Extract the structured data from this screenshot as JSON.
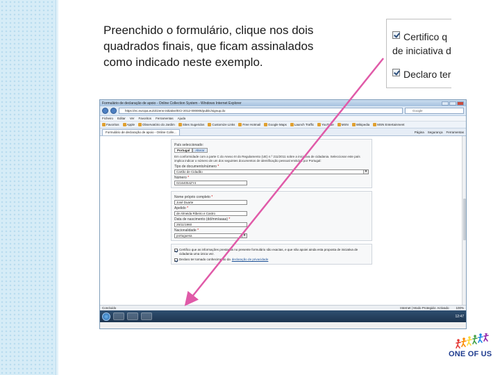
{
  "slide": {
    "instruction_lines": [
      "Preenchido o formulário, clique nos dois",
      "quadrados finais, que ficam assinalados",
      "como indicado neste exemplo."
    ]
  },
  "zoom_inset": {
    "line1": "Certifico q",
    "line2": "de iniciativa d",
    "line3": "Declaro ter"
  },
  "browser": {
    "title": "Formulário de declaração de apoio - Online Collection System - Windows Internet Explorer",
    "url": "https://ec.europa.eu/citizens-initiative/ECI-2012-000005/public/signup.do",
    "search_placeholder": "Google",
    "menu": [
      "Ficheiro",
      "Editar",
      "Ver",
      "Favoritos",
      "Ferramentas",
      "Ajuda"
    ],
    "favorites": [
      "Favoritos",
      "Apple",
      "Observatório do Jardim",
      "Sites Sugeridos",
      "Customize Links",
      "Free Hotmail",
      "Google Maps",
      "Launch Traffic",
      "YouTube",
      "MSN",
      "Wikipedia",
      "MSN Entertainment"
    ],
    "tab_label": "Formulário de declaração de apoio - Online Colle...",
    "tab_tools": [
      "Página",
      "Segurança",
      "Ferramentas"
    ],
    "form": {
      "country_label": "País seleccionado:",
      "country_value": "Portugal",
      "country_alt": "Alterar",
      "notice": "Em conformidade com a parte C do Anexo III do Regulamento (UE) n.º 211/2011 sobre a iniciativa de cidadania. Seleccionar este país implica indicar o número de um dos seguintes documentos de identificação pessoal emitidos por Portugal:",
      "notice_link": "Regulamento (UE) n.º 211/2011 sobre a iniciativa de cidadania",
      "doc_type_label": "Tipo de documento/número",
      "doc_type_value": "Cartão de Cidadão",
      "number_label": "Número",
      "number_value": "02164054ZY4",
      "fullname_label": "Nome próprio completo",
      "fullname_value": "José Duarte",
      "surname_label": "Apelido",
      "surname_value": "de Almeida Ribeiro e Castro",
      "birthdate_label": "Data de nascimento (dd/mm/aaaa)",
      "birthdate_value": "25/11/1960",
      "nationality_label": "Nacionalidade",
      "nationality_value": "portuguesa",
      "certify_text": "Certifico que as informações prestadas no presente formulário são exactas, e que não apoiei ainda esta proposta de iniciativa de cidadania uma única vez.",
      "declare_text": "Declaro ter tomado conhecimento da",
      "declare_link": "declaração de privacidade"
    },
    "status_left": "Concluído",
    "status_zone": "Internet | Modo Protegido: Activado",
    "zoom_level": "100%",
    "clock": "12:47"
  },
  "logo": {
    "text": "ONE OF US",
    "figure_colors": [
      "#e53935",
      "#fb8c00",
      "#fdd835",
      "#43a047",
      "#1e88e5",
      "#8e24aa"
    ]
  },
  "colors": {
    "arrow": "#e05aa8",
    "logo_text": "#1f3c8f"
  }
}
